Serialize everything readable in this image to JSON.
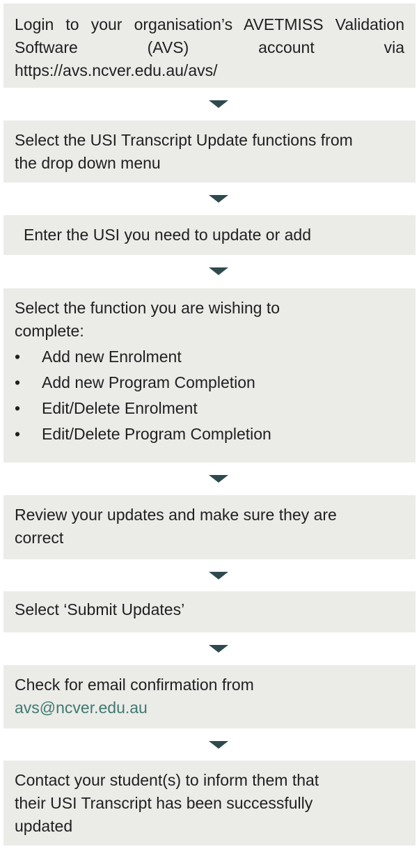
{
  "steps": [
    {
      "lines": [
        "Login to your organisation’s AVETMISS Validation Software (AVS) account via https://avs.ncver.edu.au/avs/"
      ]
    },
    {
      "lines": [
        "Select the USI Transcript Update functions from the drop down menu"
      ]
    },
    {
      "lines": [
        "Enter the USI you need to update or add"
      ]
    },
    {
      "intro": "Select the function you are wishing to complete:",
      "bullet_symbol": "•",
      "bullets": [
        "Add new Enrolment",
        "Add new Program Completion",
        "Edit/Delete Enrolment",
        "Edit/Delete Program Completion"
      ]
    },
    {
      "lines": [
        "Review your updates and make sure they are correct"
      ]
    },
    {
      "lines": [
        "Select ‘Submit Updates’"
      ]
    },
    {
      "text": "Check for email confirmation from",
      "email": "avs@ncver.edu.au"
    },
    {
      "lines": [
        "Contact your student(s) to inform them that their USI Transcript has been successfully updated"
      ]
    }
  ],
  "colors": {
    "box_background": "#ebebe8",
    "arrow": "#2f4a4f",
    "text": "#1f1f1f",
    "link": "#3e7a6f"
  }
}
